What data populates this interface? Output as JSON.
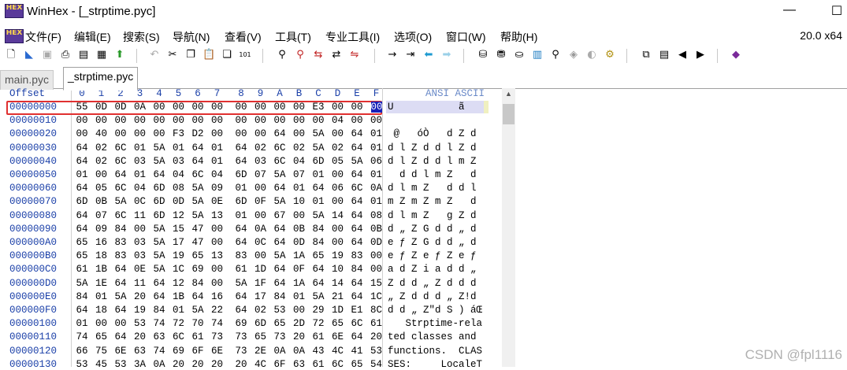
{
  "window": {
    "title": "WinHex - [_strptime.pyc]",
    "logo_text": "HEX",
    "minimize": "—",
    "maximize": "☐"
  },
  "menu": {
    "items": [
      "文件(F)",
      "编辑(E)",
      "搜索(S)",
      "导航(N)",
      "查看(V)",
      "工具(T)",
      "专业工具(I)",
      "选项(O)",
      "窗口(W)",
      "帮助(H)"
    ],
    "arch": "20.0 x64"
  },
  "tabs": [
    {
      "label": "main.pyc",
      "active": false
    },
    {
      "label": "_strptime.pyc",
      "active": true
    }
  ],
  "hex_view": {
    "offset_header": "Offset",
    "column_headers": [
      "0",
      "1",
      "2",
      "3",
      "4",
      "5",
      "6",
      "7",
      "8",
      "9",
      "A",
      "B",
      "C",
      "D",
      "E",
      "F"
    ],
    "ascii_header": "ANSI ASCII",
    "selected_row": 0,
    "cursor_byte": 15,
    "rows": [
      {
        "offset": "00000000",
        "bytes": [
          "55",
          "0D",
          "0D",
          "0A",
          "00",
          "00",
          "00",
          "00",
          "00",
          "00",
          "00",
          "00",
          "E3",
          "00",
          "00",
          "00"
        ],
        "ascii": "U           ã"
      },
      {
        "offset": "00000010",
        "bytes": [
          "00",
          "00",
          "00",
          "00",
          "00",
          "00",
          "00",
          "00",
          "00",
          "00",
          "00",
          "00",
          "00",
          "04",
          "00",
          "00"
        ],
        "ascii": ""
      },
      {
        "offset": "00000020",
        "bytes": [
          "00",
          "40",
          "00",
          "00",
          "00",
          "F3",
          "D2",
          "00",
          "00",
          "00",
          "64",
          "00",
          "5A",
          "00",
          "64",
          "01"
        ],
        "ascii": " @   óÒ   d Z d"
      },
      {
        "offset": "00000030",
        "bytes": [
          "64",
          "02",
          "6C",
          "01",
          "5A",
          "01",
          "64",
          "01",
          "64",
          "02",
          "6C",
          "02",
          "5A",
          "02",
          "64",
          "01"
        ],
        "ascii": "d l Z d d l Z d"
      },
      {
        "offset": "00000040",
        "bytes": [
          "64",
          "02",
          "6C",
          "03",
          "5A",
          "03",
          "64",
          "01",
          "64",
          "03",
          "6C",
          "04",
          "6D",
          "05",
          "5A",
          "06"
        ],
        "ascii": "d l Z d d l m Z"
      },
      {
        "offset": "00000050",
        "bytes": [
          "01",
          "00",
          "64",
          "01",
          "64",
          "04",
          "6C",
          "04",
          "6D",
          "07",
          "5A",
          "07",
          "01",
          "00",
          "64",
          "01"
        ],
        "ascii": "  d d l m Z   d"
      },
      {
        "offset": "00000060",
        "bytes": [
          "64",
          "05",
          "6C",
          "04",
          "6D",
          "08",
          "5A",
          "09",
          "01",
          "00",
          "64",
          "01",
          "64",
          "06",
          "6C",
          "0A"
        ],
        "ascii": "d l m Z   d d l"
      },
      {
        "offset": "00000070",
        "bytes": [
          "6D",
          "0B",
          "5A",
          "0C",
          "6D",
          "0D",
          "5A",
          "0E",
          "6D",
          "0F",
          "5A",
          "10",
          "01",
          "00",
          "64",
          "01"
        ],
        "ascii": "m Z m Z m Z   d"
      },
      {
        "offset": "00000080",
        "bytes": [
          "64",
          "07",
          "6C",
          "11",
          "6D",
          "12",
          "5A",
          "13",
          "01",
          "00",
          "67",
          "00",
          "5A",
          "14",
          "64",
          "08"
        ],
        "ascii": "d l m Z   g Z d"
      },
      {
        "offset": "00000090",
        "bytes": [
          "64",
          "09",
          "84",
          "00",
          "5A",
          "15",
          "47",
          "00",
          "64",
          "0A",
          "64",
          "0B",
          "84",
          "00",
          "64",
          "0B"
        ],
        "ascii": "d „ Z G d d „ d"
      },
      {
        "offset": "000000A0",
        "bytes": [
          "65",
          "16",
          "83",
          "03",
          "5A",
          "17",
          "47",
          "00",
          "64",
          "0C",
          "64",
          "0D",
          "84",
          "00",
          "64",
          "0D"
        ],
        "ascii": "e ƒ Z G d d „ d"
      },
      {
        "offset": "000000B0",
        "bytes": [
          "65",
          "18",
          "83",
          "03",
          "5A",
          "19",
          "65",
          "13",
          "83",
          "00",
          "5A",
          "1A",
          "65",
          "19",
          "83",
          "00"
        ],
        "ascii": "e ƒ Z e ƒ Z e ƒ"
      },
      {
        "offset": "000000C0",
        "bytes": [
          "61",
          "1B",
          "64",
          "0E",
          "5A",
          "1C",
          "69",
          "00",
          "61",
          "1D",
          "64",
          "0F",
          "64",
          "10",
          "84",
          "00"
        ],
        "ascii": "a d Z i a d d „"
      },
      {
        "offset": "000000D0",
        "bytes": [
          "5A",
          "1E",
          "64",
          "11",
          "64",
          "12",
          "84",
          "00",
          "5A",
          "1F",
          "64",
          "1A",
          "64",
          "14",
          "64",
          "15"
        ],
        "ascii": "Z d d „ Z d d d"
      },
      {
        "offset": "000000E0",
        "bytes": [
          "84",
          "01",
          "5A",
          "20",
          "64",
          "1B",
          "64",
          "16",
          "64",
          "17",
          "84",
          "01",
          "5A",
          "21",
          "64",
          "1C"
        ],
        "ascii": "„ Z d d d „ Z!d"
      },
      {
        "offset": "000000F0",
        "bytes": [
          "64",
          "18",
          "64",
          "19",
          "84",
          "01",
          "5A",
          "22",
          "64",
          "02",
          "53",
          "00",
          "29",
          "1D",
          "E1",
          "8C"
        ],
        "ascii": "d d „ Z\"d S ) áŒ"
      },
      {
        "offset": "00000100",
        "bytes": [
          "01",
          "00",
          "00",
          "53",
          "74",
          "72",
          "70",
          "74",
          "69",
          "6D",
          "65",
          "2D",
          "72",
          "65",
          "6C",
          "61"
        ],
        "ascii": "   Strptime-rela"
      },
      {
        "offset": "00000110",
        "bytes": [
          "74",
          "65",
          "64",
          "20",
          "63",
          "6C",
          "61",
          "73",
          "73",
          "65",
          "73",
          "20",
          "61",
          "6E",
          "64",
          "20"
        ],
        "ascii": "ted classes and "
      },
      {
        "offset": "00000120",
        "bytes": [
          "66",
          "75",
          "6E",
          "63",
          "74",
          "69",
          "6F",
          "6E",
          "73",
          "2E",
          "0A",
          "0A",
          "43",
          "4C",
          "41",
          "53"
        ],
        "ascii": "functions.  CLAS"
      },
      {
        "offset": "00000130",
        "bytes": [
          "53",
          "45",
          "53",
          "3A",
          "0A",
          "20",
          "20",
          "20",
          "20",
          "4C",
          "6F",
          "63",
          "61",
          "6C",
          "65",
          "54"
        ],
        "ascii": "SES:     LocaleT"
      }
    ]
  },
  "watermark": "CSDN @fpl1116",
  "colors": {
    "offset_blue": "#1a3fa8",
    "highlight_red": "#e03030",
    "cursor_blue": "#1820b8"
  }
}
